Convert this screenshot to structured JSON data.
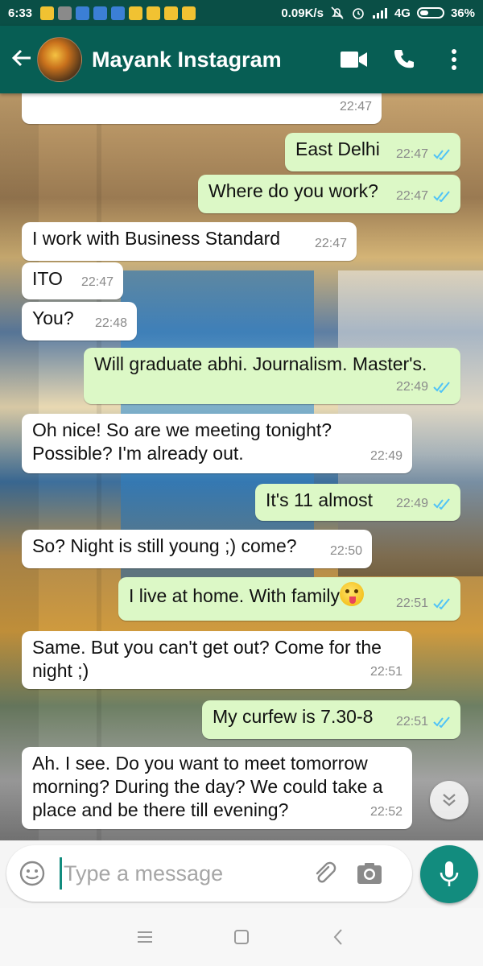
{
  "status_bar": {
    "time": "6:33",
    "net_speed": "0.09K/s",
    "network": "4G",
    "battery": "36%"
  },
  "app_bar": {
    "contact_name": "Mayank Instagram",
    "back_icon": "arrow-left-icon",
    "video_icon": "video-camera-icon",
    "call_icon": "phone-icon",
    "menu_icon": "more-vert-icon"
  },
  "colors": {
    "header": "#075e54",
    "status_bar": "#0a4f46",
    "outgoing_bubble": "#dcf8c6",
    "incoming_bubble": "#ffffff",
    "read_tick": "#4fc3f7",
    "accent": "#128c7e"
  },
  "messages": [
    {
      "dir": "in",
      "text": "",
      "time": "22:47"
    },
    {
      "dir": "out",
      "text": "East Delhi",
      "time": "22:47",
      "read": true
    },
    {
      "dir": "out",
      "text": "Where do you work?",
      "time": "22:47",
      "read": true
    },
    {
      "dir": "in",
      "text": "I work with Business Standard",
      "time": "22:47"
    },
    {
      "dir": "in",
      "text": "ITO",
      "time": "22:47"
    },
    {
      "dir": "in",
      "text": "You?",
      "time": "22:48"
    },
    {
      "dir": "out",
      "text": "Will graduate abhi. Journalism. Master's.",
      "time": "22:49",
      "read": true
    },
    {
      "dir": "in",
      "text": "Oh nice! So are we meeting tonight? Possible? I'm already out.",
      "time": "22:49"
    },
    {
      "dir": "out",
      "text": "It's 11 almost",
      "time": "22:49",
      "read": true
    },
    {
      "dir": "in",
      "text": "So? Night is still young ;) come?",
      "time": "22:50"
    },
    {
      "dir": "out",
      "text": "I live at home. With family",
      "time": "22:51",
      "read": true,
      "emoji": "tongue-out-emoji"
    },
    {
      "dir": "in",
      "text": "Same. But you can't get out? Come for the night ;)",
      "time": "22:51"
    },
    {
      "dir": "out",
      "text": "My curfew is 7.30-8",
      "time": "22:51",
      "read": true
    },
    {
      "dir": "in",
      "text": "Ah. I see. Do you want to meet tomorrow morning? During the day? We could take a place and be there till evening?",
      "time": "22:52"
    }
  ],
  "input": {
    "placeholder": "Type a message",
    "value": ""
  },
  "icons": {
    "emoji": "smiley-icon",
    "attach": "paperclip-icon",
    "camera": "camera-icon",
    "mic": "mic-icon",
    "scroll_down": "double-chevron-down-icon"
  }
}
